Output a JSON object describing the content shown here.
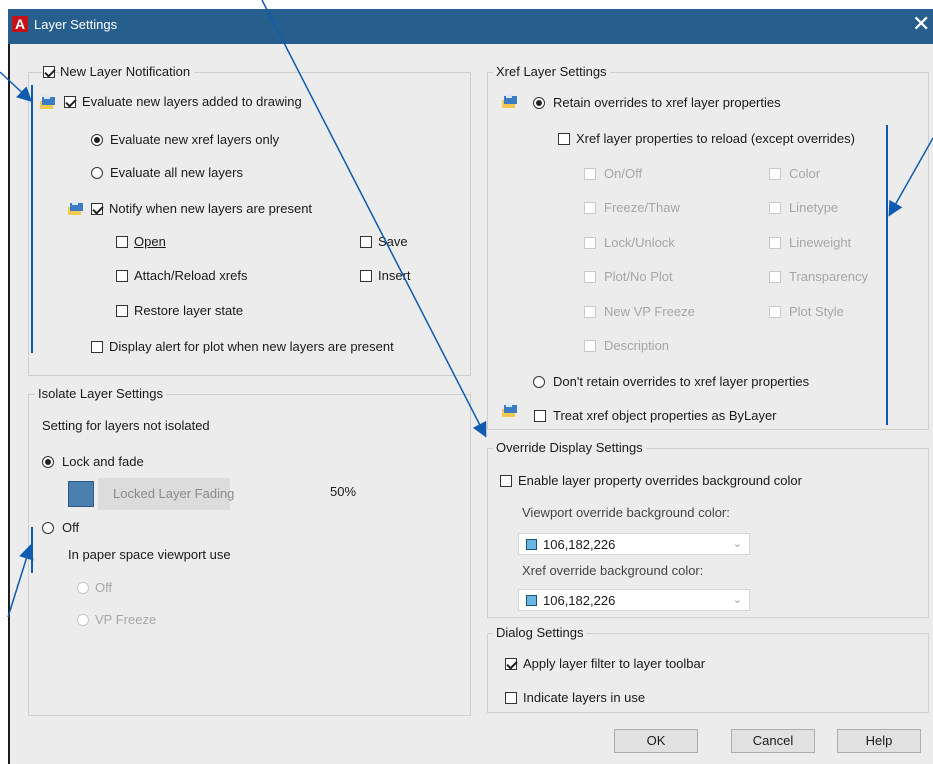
{
  "window": {
    "title": "Layer Settings",
    "logo": "A",
    "close": "✕"
  },
  "new_layer": {
    "notification": "New Layer Notification",
    "evaluate_added": "Evaluate new layers added to drawing",
    "xref_only": "Evaluate new xref layers only",
    "all_layers": "Evaluate all new layers",
    "notify_present": "Notify when new layers are present",
    "open": "Open",
    "save": "Save",
    "attach_reload": "Attach/Reload xrefs",
    "insert": "Insert",
    "restore_state": "Restore layer state",
    "plot_alert": "Display alert for plot when new layers are present"
  },
  "isolate": {
    "legend": "Isolate Layer Settings",
    "not_isolated": "Setting for layers not isolated",
    "lock_fade": "Lock and fade",
    "fading_label": "Locked Layer Fading",
    "fading_value": "50%",
    "off": "Off",
    "paper_space": "In paper space viewport use",
    "ps_off": "Off",
    "ps_vp_freeze": "VP Freeze"
  },
  "xref": {
    "legend": "Xref Layer Settings",
    "retain": "Retain overrides to xref layer properties",
    "reload": "Xref layer properties to reload (except overrides)",
    "on_off": "On/Off",
    "color": "Color",
    "freeze_thaw": "Freeze/Thaw",
    "linetype": "Linetype",
    "lock_unlock": "Lock/Unlock",
    "lineweight": "Lineweight",
    "plot_no_plot": "Plot/No Plot",
    "transparency": "Transparency",
    "new_vp_freeze": "New VP Freeze",
    "plot_style": "Plot Style",
    "description": "Description",
    "dont_retain": "Don't retain overrides to xref layer properties",
    "treat_bylayer": "Treat xref object properties as ByLayer"
  },
  "override": {
    "legend": "Override Display Settings",
    "enable": "Enable layer property overrides background color",
    "viewport_label": "Viewport override background color:",
    "viewport_value": "106,182,226",
    "xref_label": "Xref override background color:",
    "xref_value": "106,182,226",
    "swatch_color": "#6ab6e2"
  },
  "dialog_settings": {
    "legend": "Dialog Settings",
    "apply_filter": "Apply layer filter to layer toolbar",
    "indicate_use": "Indicate layers in use"
  },
  "buttons": {
    "ok": "OK",
    "cancel": "Cancel",
    "help": "Help"
  },
  "colors": {
    "titlebar": "#265f8d",
    "callout": "#0f5bb0"
  }
}
